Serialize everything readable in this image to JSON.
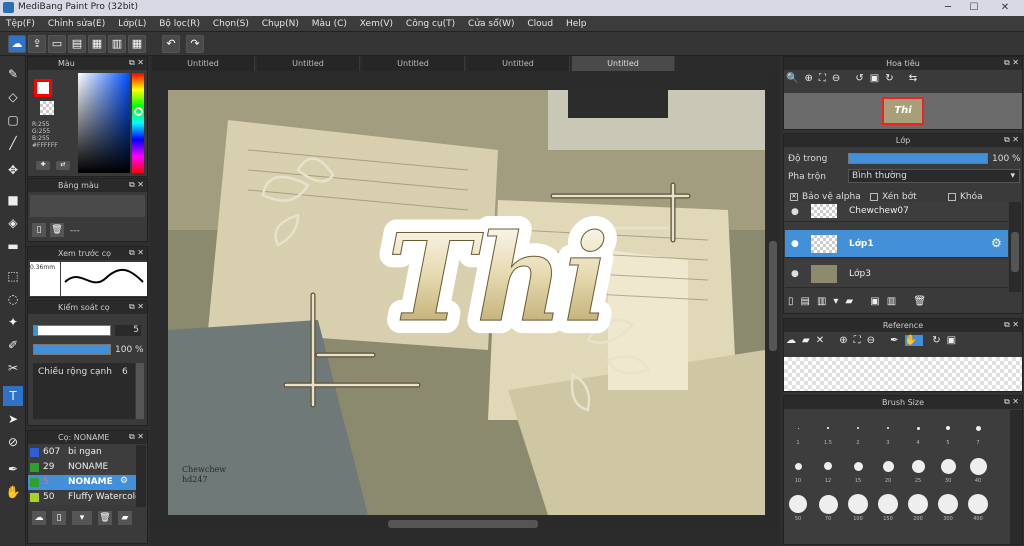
{
  "window": {
    "title": "MediBang Paint Pro (32bit)"
  },
  "menu": [
    "Tệp(F)",
    "Chỉnh sửa(E)",
    "Lớp(L)",
    "Bộ lọc(R)",
    "Chọn(S)",
    "Chụp(N)",
    "Màu (C)",
    "Xem(V)",
    "Công cụ(T)",
    "Cửa sổ(W)",
    "Cloud",
    "Help"
  ],
  "tabs": [
    "Untitled",
    "Untitled",
    "Untitled",
    "Untitled",
    "Untitled"
  ],
  "color_panel": {
    "title": "Màu",
    "r": "R:255",
    "g": "G:255",
    "b": "B:255",
    "hex": "#FFFFFF"
  },
  "palette_panel": {
    "title": "Bảng màu",
    "empty": "---"
  },
  "preview_panel": {
    "title": "Xem trước cọ",
    "size": "0.36mm"
  },
  "brush_control": {
    "title": "Kiểm soát cọ",
    "size_val": "5",
    "opacity_val": "100 %",
    "width_label": "Chiều rộng cạnh",
    "width_val": "6"
  },
  "brush_list": {
    "title": "Cọ: NONAME",
    "items": [
      {
        "num": "607",
        "name": "bi ngan",
        "color": "#2d5fd6"
      },
      {
        "num": "29",
        "name": "NONAME",
        "color": "#2fa02f"
      },
      {
        "num": "5",
        "name": "NONAME",
        "color": "#2fa02f"
      },
      {
        "num": "50",
        "name": "Fluffy Watercolor",
        "color": "#a6d32a"
      }
    ]
  },
  "canvas": {
    "text": "Thi",
    "watermark": "Chewchew\nhd247"
  },
  "navigator": {
    "title": "Hoa tiêu"
  },
  "layer_panel": {
    "title": "Lớp",
    "opacity_label": "Độ trong",
    "opacity_val": "100 %",
    "opacity": 1.0,
    "blend_label": "Pha trộn",
    "blend_val": "Bình thường",
    "protect_alpha": "Bảo vệ alpha",
    "clipping": "Xén bớt",
    "lock": "Khóa",
    "layers": [
      {
        "name": "Chewchew07"
      },
      {
        "name": "Lớp1"
      },
      {
        "name": "Lớp3"
      }
    ]
  },
  "reference_panel": {
    "title": "Reference"
  },
  "brushsize_panel": {
    "title": "Brush Size",
    "sizes": [
      "1",
      "1.5",
      "2",
      "3",
      "4",
      "5",
      "7",
      "10",
      "12",
      "15",
      "20",
      "25",
      "30",
      "40",
      "50",
      "70",
      "100",
      "150",
      "200",
      "300",
      "400"
    ]
  },
  "colors": {
    "accent": "#4390d8",
    "fg": "#ff0000",
    "bg": "#ffffff"
  }
}
